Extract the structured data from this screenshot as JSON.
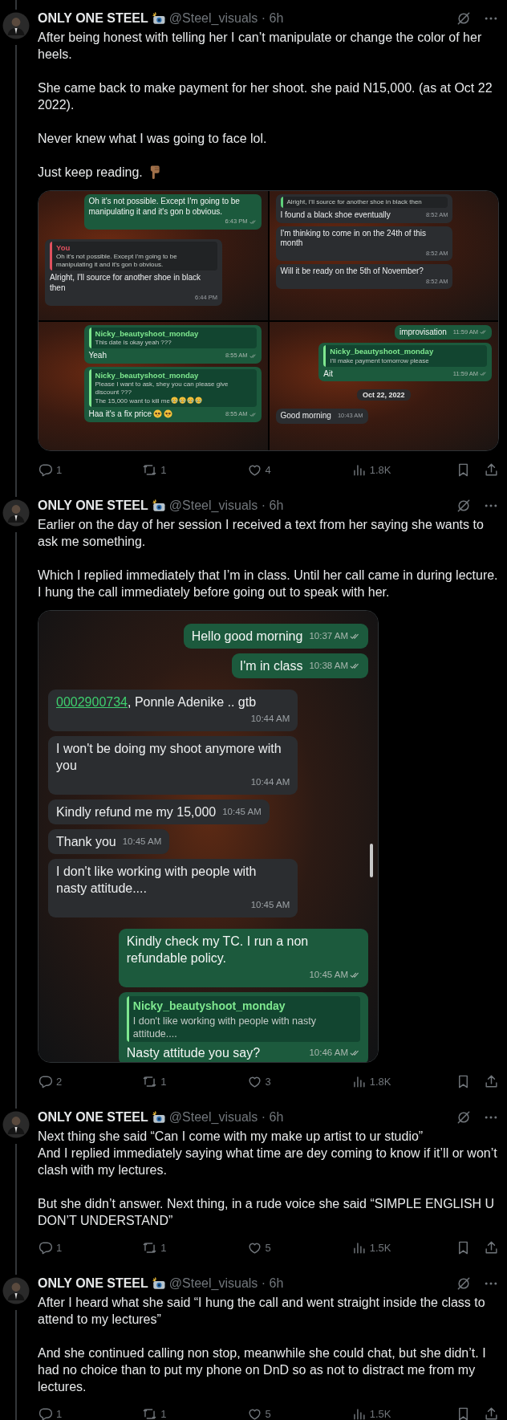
{
  "tweets": [
    {
      "author": "ONLY ONE STEEL",
      "badge": {
        "kind": "camera"
      },
      "meta": "@Steel_visuals · 6h",
      "paragraphs": [
        {
          "text": "After being honest with telling her I can’t manipulate or change the color of her heels."
        },
        {
          "text": "She came back to make payment for her shoot.  she paid N15,000. (as at Oct 22 2022)."
        },
        {
          "text": "Never knew what I was going to face lol."
        },
        {
          "text": "Just keep reading.",
          "emojis": [
            {
              "kind": "point-down"
            }
          ]
        }
      ],
      "media": {
        "kind": "grid",
        "panels": [
          {
            "messages": [
              {
                "kind": "sent",
                "text": "Oh it's not possible. Except I'm going to be manipulating it and it's gon b obvious.",
                "time": "6:43 PM"
              },
              {
                "kind": "received",
                "quote": {
                  "author": "You",
                  "text": "Oh it's not possible. Except I'm going to be manipulating it and it's gon b obvious.",
                  "color": "#e0505e"
                },
                "text": "Alright, I'll source for another shoe in black then",
                "time": "6:44 PM"
              }
            ]
          },
          {
            "messages": [
              {
                "kind": "received",
                "quote": {
                  "text": "Alright, I'll source for another shoe in black then",
                  "color": "#5fd07a"
                },
                "text": "I found a black shoe eventually",
                "time": "8:52 AM"
              },
              {
                "kind": "received",
                "text": "I'm thinking to come in on the 24th of this month",
                "time": "8:52 AM"
              },
              {
                "kind": "received",
                "text": "Will it be ready on the 5th of November?",
                "time": "8:52 AM"
              }
            ]
          },
          {
            "messages": [
              {
                "kind": "sent",
                "quote": {
                  "author": "Nicky_beautyshoot_monday",
                  "text": "This date is okay yeah ???",
                  "color": "#7ee88f"
                },
                "text": "Yeah",
                "time": "8:55 AM"
              },
              {
                "kind": "sent",
                "quote": {
                  "author": "Nicky_beautyshoot_monday",
                  "text": "Please I want to ask, shey you can please give discount ???\nThe 15,000 want to kill me",
                  "color": "#7ee88f",
                  "emojis": [
                    {
                      "kind": "crying"
                    },
                    {
                      "kind": "crying"
                    },
                    {
                      "kind": "crying"
                    },
                    {
                      "kind": "crying"
                    }
                  ]
                },
                "text": "Haa it's a fix price",
                "emojis": [
                  {
                    "kind": "pleading"
                  },
                  {
                    "kind": "pleading"
                  }
                ],
                "time": "8:55 AM"
              }
            ]
          },
          {
            "messages": [
              {
                "kind": "sent",
                "text": "improvisation",
                "time": "11:59 AM"
              },
              {
                "kind": "sent",
                "quote": {
                  "author": "Nicky_beautyshoot_monday",
                  "text": "I'll make payment tomorrow please",
                  "color": "#7ee88f"
                },
                "text": "Ait",
                "time": "11:59 AM"
              },
              {
                "kind": "date",
                "text": "Oct 22, 2022"
              },
              {
                "kind": "received",
                "text": "Good morning",
                "time": "10:43 AM"
              }
            ]
          }
        ]
      },
      "stats": {
        "replies": "1",
        "reposts": "1",
        "likes": "4",
        "views": "1.8K"
      }
    },
    {
      "author": "ONLY ONE STEEL",
      "badge": {
        "kind": "camera"
      },
      "meta": "@Steel_visuals · 6h",
      "paragraphs": [
        {
          "text": "Earlier on the day of her session I received a text from her saying she wants to ask me something."
        },
        {
          "text": "Which I replied immediately that I’m in class. Until her call came in during lecture. I hung the call immediately before going out to speak with her."
        }
      ],
      "media": {
        "kind": "single",
        "panels": [
          {
            "messages": [
              {
                "kind": "sent",
                "text": "Hello good morning",
                "time": "10:37 AM"
              },
              {
                "kind": "sent",
                "text": "I'm in class",
                "time": "10:38 AM"
              },
              {
                "kind": "received",
                "link": "0002900734",
                "text": ", Ponnle Adenike .. gtb",
                "time": "10:44 AM"
              },
              {
                "kind": "received",
                "text": "I won't be doing my shoot anymore with you",
                "time": "10:44 AM"
              },
              {
                "kind": "received",
                "text": "Kindly refund me my 15,000",
                "time": "10:45 AM"
              },
              {
                "kind": "received",
                "text": "Thank you",
                "time": "10:45 AM"
              },
              {
                "kind": "received",
                "text": "I don't like working with people with nasty attitude....",
                "time": "10:45 AM"
              },
              {
                "kind": "sent",
                "text": "Kindly check my TC. I run a non refundable policy.",
                "time": "10:45 AM"
              },
              {
                "kind": "sent",
                "quote": {
                  "author": "Nicky_beautyshoot_monday",
                  "text": "I don't like working with people with nasty attitude....",
                  "color": "#7ee88f"
                },
                "text": "Nasty attitude you say?",
                "time": "10:46 AM"
              }
            ]
          }
        ]
      },
      "stats": {
        "replies": "2",
        "reposts": "1",
        "likes": "3",
        "views": "1.8K"
      }
    },
    {
      "author": "ONLY ONE STEEL",
      "badge": {
        "kind": "camera"
      },
      "meta": "@Steel_visuals · 6h",
      "paragraphs": [
        {
          "text": "Next thing she said “Can I come with my make up artist to ur studio”\nAnd I replied immediately saying what time are dey coming to know if it’ll or won’t clash with my lectures."
        },
        {
          "text": "But she didn’t answer. Next thing, in a rude voice she said “SIMPLE ENGLISH U DON’T UNDERSTAND”"
        }
      ],
      "stats": {
        "replies": "1",
        "reposts": "1",
        "likes": "5",
        "views": "1.5K"
      }
    },
    {
      "author": "ONLY ONE STEEL",
      "badge": {
        "kind": "camera"
      },
      "meta": "@Steel_visuals · 6h",
      "paragraphs": [
        {
          "text": "After I heard what she said “I hung the call and went straight inside the class to attend to my lectures”"
        },
        {
          "text": "And she continued calling non stop, meanwhile she could chat, but she didn’t. I had no choice than to put my phone on DnD so as not to distract me from my lectures."
        }
      ],
      "stats": {
        "replies": "1",
        "reposts": "1",
        "likes": "5",
        "views": "1.5K"
      }
    }
  ]
}
